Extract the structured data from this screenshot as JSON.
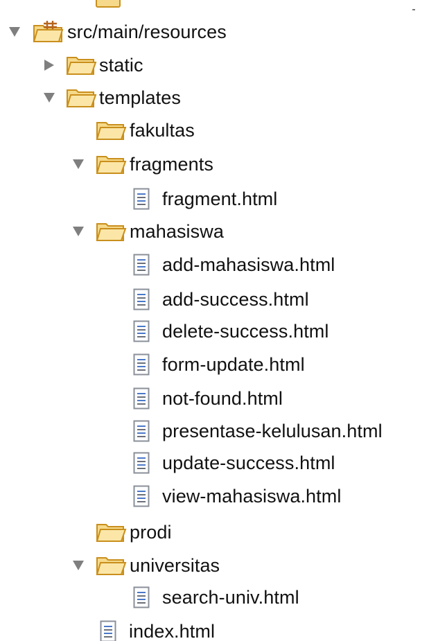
{
  "tree": {
    "root": {
      "label": "src/main/resources",
      "icon": "package-folder-icon",
      "expanded": true
    },
    "nodes": [
      {
        "label": "static",
        "type": "folder",
        "expanded": false
      },
      {
        "label": "templates",
        "type": "folder",
        "expanded": true
      },
      {
        "label": "fakultas",
        "type": "folder",
        "expanded": null
      },
      {
        "label": "fragments",
        "type": "folder",
        "expanded": true
      },
      {
        "label": "fragment.html",
        "type": "file"
      },
      {
        "label": "mahasiswa",
        "type": "folder",
        "expanded": true
      },
      {
        "label": "add-mahasiswa.html",
        "type": "file"
      },
      {
        "label": "add-success.html",
        "type": "file"
      },
      {
        "label": "delete-success.html",
        "type": "file"
      },
      {
        "label": "form-update.html",
        "type": "file"
      },
      {
        "label": "not-found.html",
        "type": "file"
      },
      {
        "label": "presentase-kelulusan.html",
        "type": "file"
      },
      {
        "label": "update-success.html",
        "type": "file"
      },
      {
        "label": "view-mahasiswa.html",
        "type": "file"
      },
      {
        "label": "prodi",
        "type": "folder",
        "expanded": null
      },
      {
        "label": "universitas",
        "type": "folder",
        "expanded": true
      },
      {
        "label": "search-univ.html",
        "type": "file"
      },
      {
        "label": "index.html",
        "type": "file"
      }
    ]
  },
  "colors": {
    "folder_fill": "#f6d98a",
    "folder_stroke": "#c98f1c",
    "twisty": "#7f7f7f",
    "file_border": "#8a8f99",
    "file_lines": "#4a78c8",
    "package_accent": "#b5651d"
  }
}
